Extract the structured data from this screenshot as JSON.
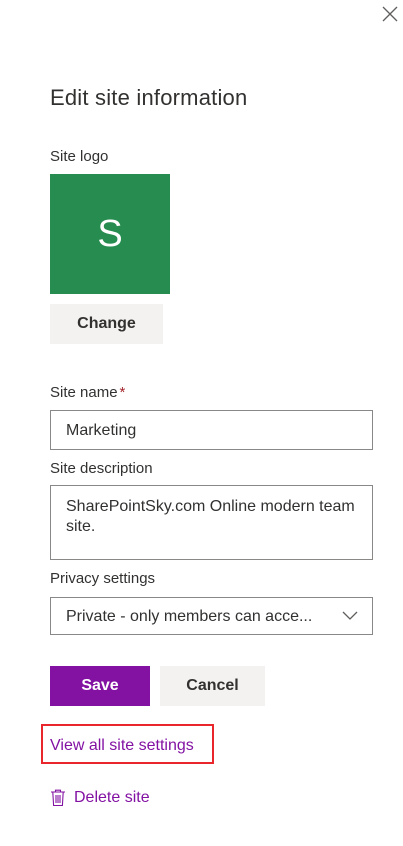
{
  "panel": {
    "title": "Edit site information",
    "close_icon": "close-icon"
  },
  "logo": {
    "label": "Site logo",
    "letter": "S",
    "tile_color": "#278c50",
    "change_label": "Change"
  },
  "site_name": {
    "label": "Site name",
    "required_marker": "*",
    "value": "Marketing"
  },
  "site_description": {
    "label": "Site description",
    "value": "SharePointSky.com Online modern team site."
  },
  "privacy": {
    "label": "Privacy settings",
    "selected": "Private - only members can acce...",
    "icon": "chevron-down-icon"
  },
  "actions": {
    "save_label": "Save",
    "cancel_label": "Cancel",
    "accent_color": "#8312a3"
  },
  "links": {
    "view_all_settings": "View all site settings",
    "delete_site": "Delete site",
    "delete_icon": "trash-icon",
    "highlight_color": "#e8262c"
  }
}
